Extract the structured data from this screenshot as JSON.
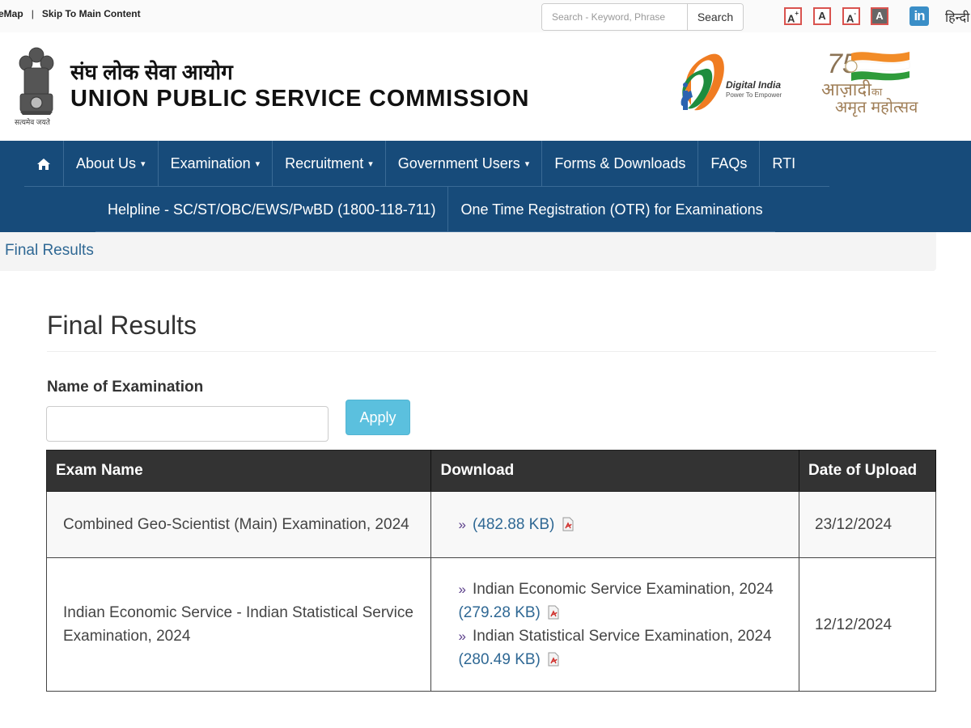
{
  "topbar": {
    "sitemap_label": "eMap",
    "separator": "|",
    "skip_label": "Skip To Main Content",
    "search_placeholder": "Search - Keyword, Phrase",
    "search_button": "Search",
    "font_increase": "A",
    "font_increase_sup": "+",
    "font_normal": "A",
    "font_decrease": "A",
    "font_decrease_sup": "-",
    "high_contrast": "A",
    "linkedin_label": "in",
    "language_link": "हिन्दी"
  },
  "header": {
    "emblem_caption": "सत्यमेव जयते",
    "title_hindi": "संघ लोक सेवा आयोग",
    "title_english": "UNION PUBLIC SERVICE COMMISSION",
    "digital_india_title": "Digital India",
    "digital_india_tagline": "Power To Empower",
    "aka_line1": "आज़ादी",
    "aka_line1_small": "का",
    "aka_line2": "अमृत महोत्सव",
    "aka_number": "75"
  },
  "nav": {
    "primary": [
      {
        "label": "About Us",
        "dropdown": true
      },
      {
        "label": "Examination",
        "dropdown": true
      },
      {
        "label": "Recruitment",
        "dropdown": true
      },
      {
        "label": "Government Users",
        "dropdown": true
      },
      {
        "label": "Forms & Downloads",
        "dropdown": false
      },
      {
        "label": "FAQs",
        "dropdown": false
      },
      {
        "label": "RTI",
        "dropdown": false
      }
    ],
    "secondary": [
      {
        "label": "Helpline - SC/ST/OBC/EWS/PwBD (1800-118-711)"
      },
      {
        "label": "One Time Registration (OTR) for Examinations"
      }
    ],
    "caret": "▾"
  },
  "breadcrumb": {
    "current": "Final Results"
  },
  "main": {
    "title": "Final Results",
    "filter_label": "Name of Examination",
    "filter_value": "",
    "apply_button": "Apply",
    "table": {
      "headers": [
        "Exam Name",
        "Download",
        "Date of Upload"
      ],
      "rows": [
        {
          "exam_name": "Combined Geo-Scientist (Main) Examination, 2024",
          "downloads": [
            {
              "title": "",
              "size": "(482.88 KB)"
            }
          ],
          "date": "23/12/2024"
        },
        {
          "exam_name": "Indian Economic Service - Indian Statistical Service Examination, 2024",
          "downloads": [
            {
              "title": "Indian Economic Service Examination, 2024",
              "size": "(279.28 KB)"
            },
            {
              "title": "Indian Statistical Service Examination, 2024",
              "size": "(280.49 KB)"
            }
          ],
          "date": "12/12/2024"
        }
      ],
      "bullet": "»"
    }
  },
  "colors": {
    "navbar": "#174b7a",
    "link": "#2f6894",
    "apply_button": "#5bc0de",
    "table_header": "#333333",
    "font_ctrl_border": "#d9534f"
  }
}
